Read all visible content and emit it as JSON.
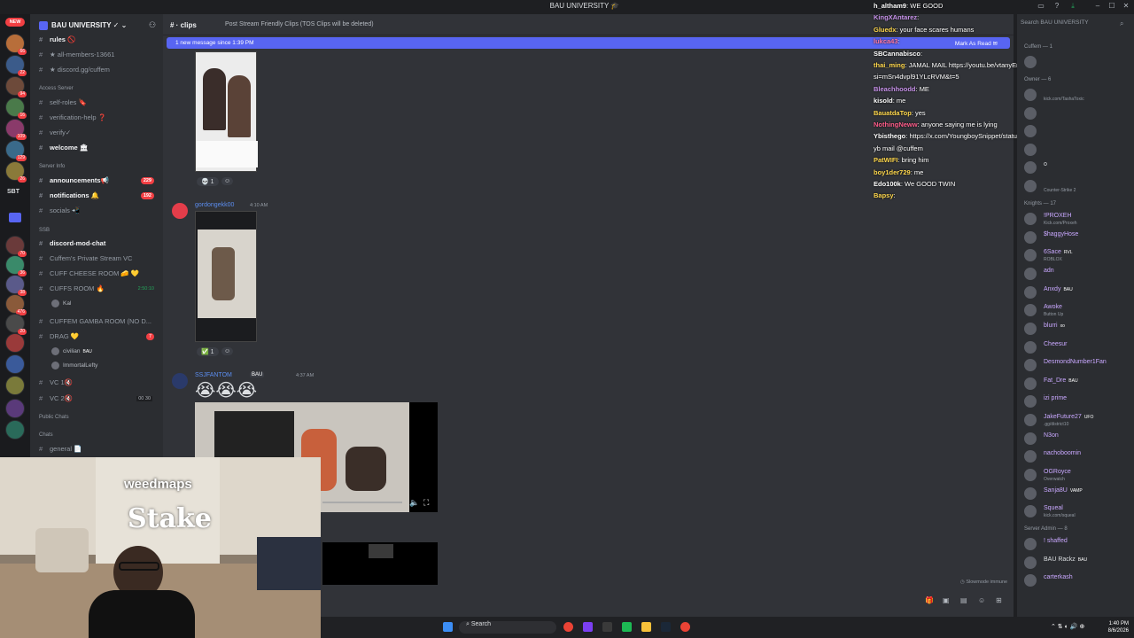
{
  "window": {
    "title": "BAU UNIVERSITY",
    "title_icon": "graduation-cap-icon"
  },
  "server_rail": {
    "new_label": "NEW",
    "sbt_label": "SBT",
    "badges": [
      "66",
      "22",
      "94",
      "16",
      "109",
      "129",
      "26",
      "70",
      "36",
      "38",
      "476",
      "20"
    ]
  },
  "server": {
    "name": "BAU UNIVERSITY"
  },
  "channels": [
    {
      "label": "rules 🚫",
      "bold": true
    },
    {
      "label": "★ all-members-13661",
      "bold": false
    },
    {
      "label": "★ discord.gg/cuffem",
      "bold": false
    },
    {
      "label": "Access Server",
      "category": true
    },
    {
      "label": "self-roles 🔖",
      "bold": false
    },
    {
      "label": "verification-help ❓",
      "bold": false
    },
    {
      "label": "verify✓",
      "bold": false
    },
    {
      "label": "welcome 🏛",
      "bold": true
    },
    {
      "label": "Server Info",
      "category": true
    },
    {
      "label": "announcements📢",
      "bold": true,
      "badge": "229"
    },
    {
      "label": "notifications 🔔",
      "bold": true,
      "badge": "192"
    },
    {
      "label": "socials 📲",
      "bold": false
    },
    {
      "label": "SSB",
      "category": true
    },
    {
      "label": "discord-mod-chat",
      "bold": true
    },
    {
      "label": "Cuffem's Private Stream VC",
      "bold": false
    },
    {
      "label": "CUFF CHEESE ROOM 🧀 💛",
      "bold": false
    },
    {
      "label": "CUFFS ROOM 🔥",
      "bold": false,
      "timer": "2:50:10"
    },
    {
      "label": "CUFFEM GAMBA ROOM (NO D...",
      "bold": false
    },
    {
      "label": "DRAG 💛",
      "bold": false,
      "badge": "7"
    },
    {
      "label": "VC 1🔇",
      "bold": false
    },
    {
      "label": "VC 2🔇",
      "bold": false,
      "counter": "00 30"
    },
    {
      "label": "Public Chats",
      "category": true
    },
    {
      "label": "Chats",
      "category": true
    },
    {
      "label": "general 📄",
      "bold": false
    }
  ],
  "voice_users": [
    {
      "name": "Kal"
    },
    {
      "name": "civilian",
      "tag": "BAU"
    },
    {
      "name": "ImmortalLefty"
    }
  ],
  "chat": {
    "channel": "clips",
    "topic": "Post Stream Friendly Clips (TOS Clips will be deleted)",
    "new_messages": "1 new message since 1:39 PM",
    "mark_read": "Mark As Read",
    "messages": [
      {
        "reaction": "💀 1"
      },
      {
        "user": "gordongekk00",
        "time": "4:10 AM",
        "reaction": "✅ 1"
      },
      {
        "user": "SSJFANTOM",
        "tag": "BAU",
        "time": "4:37 AM",
        "content": "😭😭😭"
      }
    ],
    "slowmode": "Slowmode immune"
  },
  "overlay_chat": [
    {
      "user": "h_altham9",
      "color": "#ffffff",
      "msg": "WE GOOD"
    },
    {
      "user": "KingXAntarez",
      "color": "#c792ea",
      "msg": ""
    },
    {
      "user": "Gluedx",
      "color": "#ffd84d",
      "msg": "your face scares humans"
    },
    {
      "user": "lukca43",
      "color": "#ff7aa8",
      "msg": ""
    },
    {
      "user": "SBCannabisco",
      "color": "#ffffff",
      "msg": ""
    },
    {
      "user": "thai_ming",
      "color": "#ffd84d",
      "msg": "JAMAL MAIL https://youtu.be/vtanyEnwhYc?"
    },
    {
      "user": "",
      "color": "#ffffff",
      "msg": "si=mSn4dvpl91YLcRVM&t=5"
    },
    {
      "user": "Bleachhoodd",
      "color": "#c792ea",
      "msg": "ME"
    },
    {
      "user": "kisold",
      "color": "#ffffff",
      "msg": "me"
    },
    {
      "user": "BauatdaTop",
      "color": "#ffd84d",
      "msg": "yes"
    },
    {
      "user": "NothingNeww",
      "color": "#ff5c8a",
      "msg": "anyone saying me is lying"
    },
    {
      "user": "Ybisthego",
      "color": "#ffffff",
      "msg": "https://x.com/YoungboySnippet/status/2085425948699074588?s=20"
    },
    {
      "user": "",
      "color": "#ffffff",
      "msg": "yb mail @cuffem"
    },
    {
      "user": "PatWIFI",
      "color": "#ffd84d",
      "msg": "bring him"
    },
    {
      "user": "boy1der729",
      "color": "#ffd84d",
      "msg": "me"
    },
    {
      "user": "Edo100k",
      "color": "#ffffff",
      "msg": "We GOOD TWIN"
    },
    {
      "user": "Bapsy",
      "color": "#ffd84d",
      "msg": ""
    }
  ],
  "members": {
    "search_placeholder": "Search BAU UNIVERSITY",
    "groups": [
      {
        "label": "Cuffem — 1",
        "members": [
          {
            "name": "",
            "color": "#dbdee1"
          }
        ]
      },
      {
        "label": "Owner — 6",
        "members": [
          {
            "name": "",
            "sub": "kick.com/TashaToxic",
            "color": "#f47fff"
          },
          {
            "name": "",
            "color": "#dbdee1"
          },
          {
            "name": "",
            "color": "#dbdee1"
          },
          {
            "name": "",
            "color": "#dbdee1"
          },
          {
            "name": "o",
            "color": "#dbdee1"
          },
          {
            "name": "",
            "sub": "Counter-Strike 2",
            "color": "#dbdee1"
          }
        ]
      },
      {
        "label": "Knights — 17",
        "members": [
          {
            "name": "!PROXEH",
            "sub": "Kick.com/Proxeh",
            "color": "#c9a8ff"
          },
          {
            "name": "$haggyHose",
            "color": "#c9a8ff"
          },
          {
            "name": "6Sace",
            "tag": "RVL",
            "sub": "ROBLOX",
            "color": "#c9a8ff"
          },
          {
            "name": "adn",
            "color": "#c9a8ff"
          },
          {
            "name": "Anxdy",
            "tag": "BAU",
            "color": "#c9a8ff"
          },
          {
            "name": "Awoke",
            "sub": "Button Up",
            "color": "#c9a8ff"
          },
          {
            "name": "blurri",
            "tag": "xo",
            "color": "#c9a8ff"
          },
          {
            "name": "Cheesur",
            "color": "#c9a8ff"
          },
          {
            "name": "DesmondNumber1Fan",
            "color": "#c9a8ff"
          },
          {
            "name": "Fat_Dre",
            "tag": "BAU",
            "color": "#c9a8ff"
          },
          {
            "name": "izi prime",
            "color": "#c9a8ff"
          },
          {
            "name": "JakeFuture27",
            "tag": "UFO",
            "sub": ".gg/district10",
            "color": "#c9a8ff"
          },
          {
            "name": "N3on",
            "color": "#c9a8ff"
          },
          {
            "name": "nachoboomin",
            "color": "#c9a8ff"
          },
          {
            "name": "OGRoyce",
            "sub": "Overwatch",
            "color": "#c9a8ff"
          },
          {
            "name": "Sanja8U",
            "tag": "VAMP",
            "color": "#c9a8ff"
          },
          {
            "name": "Squeal",
            "sub": "kick.com/squeal",
            "color": "#c9a8ff"
          }
        ]
      },
      {
        "label": "Server Admin — 8",
        "members": [
          {
            "name": "! shaffed",
            "color": "#c9a8ff"
          },
          {
            "name": "BAU Rackz",
            "tag": "BAU",
            "color": "#dbdee1"
          },
          {
            "name": "carterkash",
            "color": "#c9a8ff"
          }
        ]
      }
    ]
  },
  "webcam": {
    "sign1": "weedmaps",
    "sign2": "Stake"
  },
  "taskbar": {
    "search_label": "Search",
    "time": "1:40 PM",
    "date": "8/6/2026"
  },
  "colors": {
    "accent": "#5865f2",
    "danger": "#f23f43",
    "bg": "#313338",
    "sidebar": "#2b2d31"
  }
}
